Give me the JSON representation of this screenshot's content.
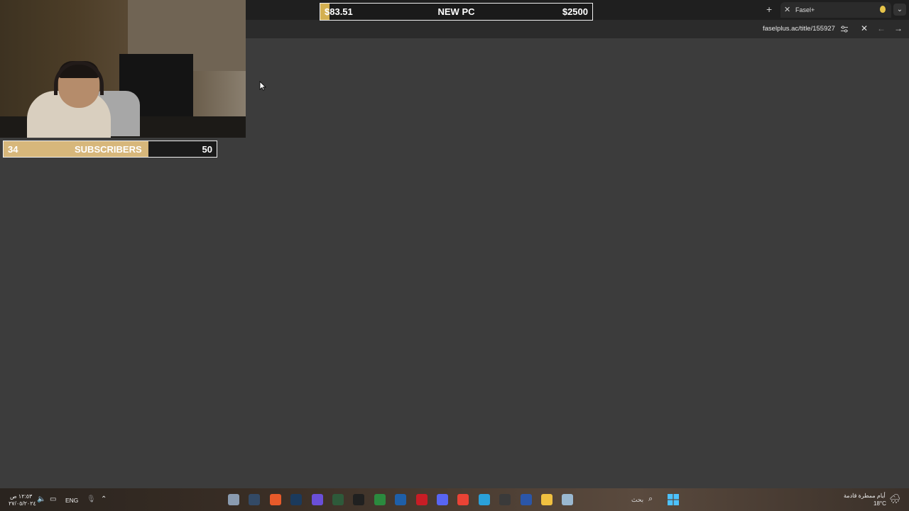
{
  "browser": {
    "tab": {
      "title": "Fasel+",
      "close": "✕"
    },
    "new_tab": "+",
    "tab_menu": "⌄",
    "url": "faselplus.ac/title/155927",
    "toolbar_icons": {
      "close": "✕",
      "back": "←",
      "forward": "→"
    }
  },
  "overlays": {
    "pc_goal": {
      "current": "$83.51",
      "label": "NEW PC",
      "target": "$2500",
      "progress": 0.0334
    },
    "sub_goal": {
      "current": "34",
      "label": "SUBSCRIBERS",
      "target": "50",
      "progress": 0.68
    }
  },
  "taskbar": {
    "time": "١٢:٥٣ ص",
    "date": "٢٧/٠٥/٢٠٢٤",
    "language": "ENG",
    "search_label": "بحث",
    "weather_desc": "أيام ممطرة قادمة",
    "temperature": "18°C",
    "pinned_apps": [
      {
        "name": "settings-icon",
        "color": "#8a9bb0"
      },
      {
        "name": "sketchbook-icon",
        "color": "#334a66"
      },
      {
        "name": "game-launcher-icon",
        "color": "#e85a2a"
      },
      {
        "name": "steam-icon",
        "color": "#1b3a5c"
      },
      {
        "name": "controller-app-icon",
        "color": "#6a4fd8"
      },
      {
        "name": "terminal-app-icon",
        "color": "#2e5a3a"
      },
      {
        "name": "logitech-icon",
        "color": "#202020"
      },
      {
        "name": "xbox-icon",
        "color": "#2b8a3e"
      },
      {
        "name": "photos-app-icon",
        "color": "#1f5fa8"
      },
      {
        "name": "netflix-icon",
        "color": "#c81d25"
      },
      {
        "name": "discord-icon",
        "color": "#5865f2"
      },
      {
        "name": "chrome-icon",
        "color": "#ea4335"
      },
      {
        "name": "telegram-icon",
        "color": "#2aa1da"
      },
      {
        "name": "store-icon",
        "color": "#3a3a3a"
      },
      {
        "name": "media-app-icon",
        "color": "#2b56a8"
      },
      {
        "name": "file-explorer-icon",
        "color": "#f0c040"
      },
      {
        "name": "cloud-app-icon",
        "color": "#9ab8d0"
      }
    ]
  }
}
